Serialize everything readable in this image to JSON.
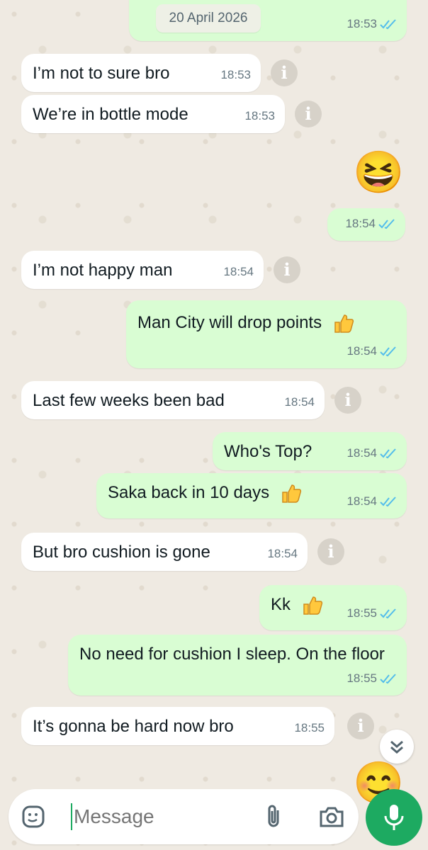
{
  "date_badge": "20 April 2026",
  "messages": [
    {
      "dir": "out",
      "text": "",
      "time": "18:53"
    },
    {
      "dir": "in",
      "text": "I’m not to sure bro",
      "time": "18:53"
    },
    {
      "dir": "in",
      "text": "We’re in bottle mode",
      "time": "18:53"
    },
    {
      "dir": "out",
      "text": "😆",
      "time": "18:54"
    },
    {
      "dir": "in",
      "text": "I’m not happy man",
      "time": "18:54"
    },
    {
      "dir": "out",
      "text": "Man City will drop points",
      "time": "18:54"
    },
    {
      "dir": "in",
      "text": "Last few weeks been bad",
      "time": "18:54"
    },
    {
      "dir": "out",
      "text": "Who's Top?",
      "time": "18:54"
    },
    {
      "dir": "out",
      "text": "Saka back in 10 days",
      "time": "18:54"
    },
    {
      "dir": "in",
      "text": "But bro cushion is gone",
      "time": "18:54"
    },
    {
      "dir": "out",
      "text": "Kk",
      "time": "18:55"
    },
    {
      "dir": "out",
      "text": "No need for cushion I sleep. On the floor",
      "time": "18:55"
    },
    {
      "dir": "in",
      "text": "It’s gonna be hard now bro",
      "time": "18:55"
    },
    {
      "dir": "out",
      "text": "😊",
      "time": ""
    }
  ],
  "info_icon": "i",
  "composer": {
    "placeholder": "Message"
  },
  "icons": {
    "sticker": "sticker-icon",
    "attach": "paperclip-icon",
    "camera": "camera-icon",
    "mic": "mic-icon",
    "scroll": "double-chevron-down-icon"
  },
  "colors": {
    "incoming": "#ffffff",
    "outgoing": "#d9fdd3",
    "tick": "#53bdeb",
    "mic": "#1daa61",
    "background": "#efeae2"
  }
}
